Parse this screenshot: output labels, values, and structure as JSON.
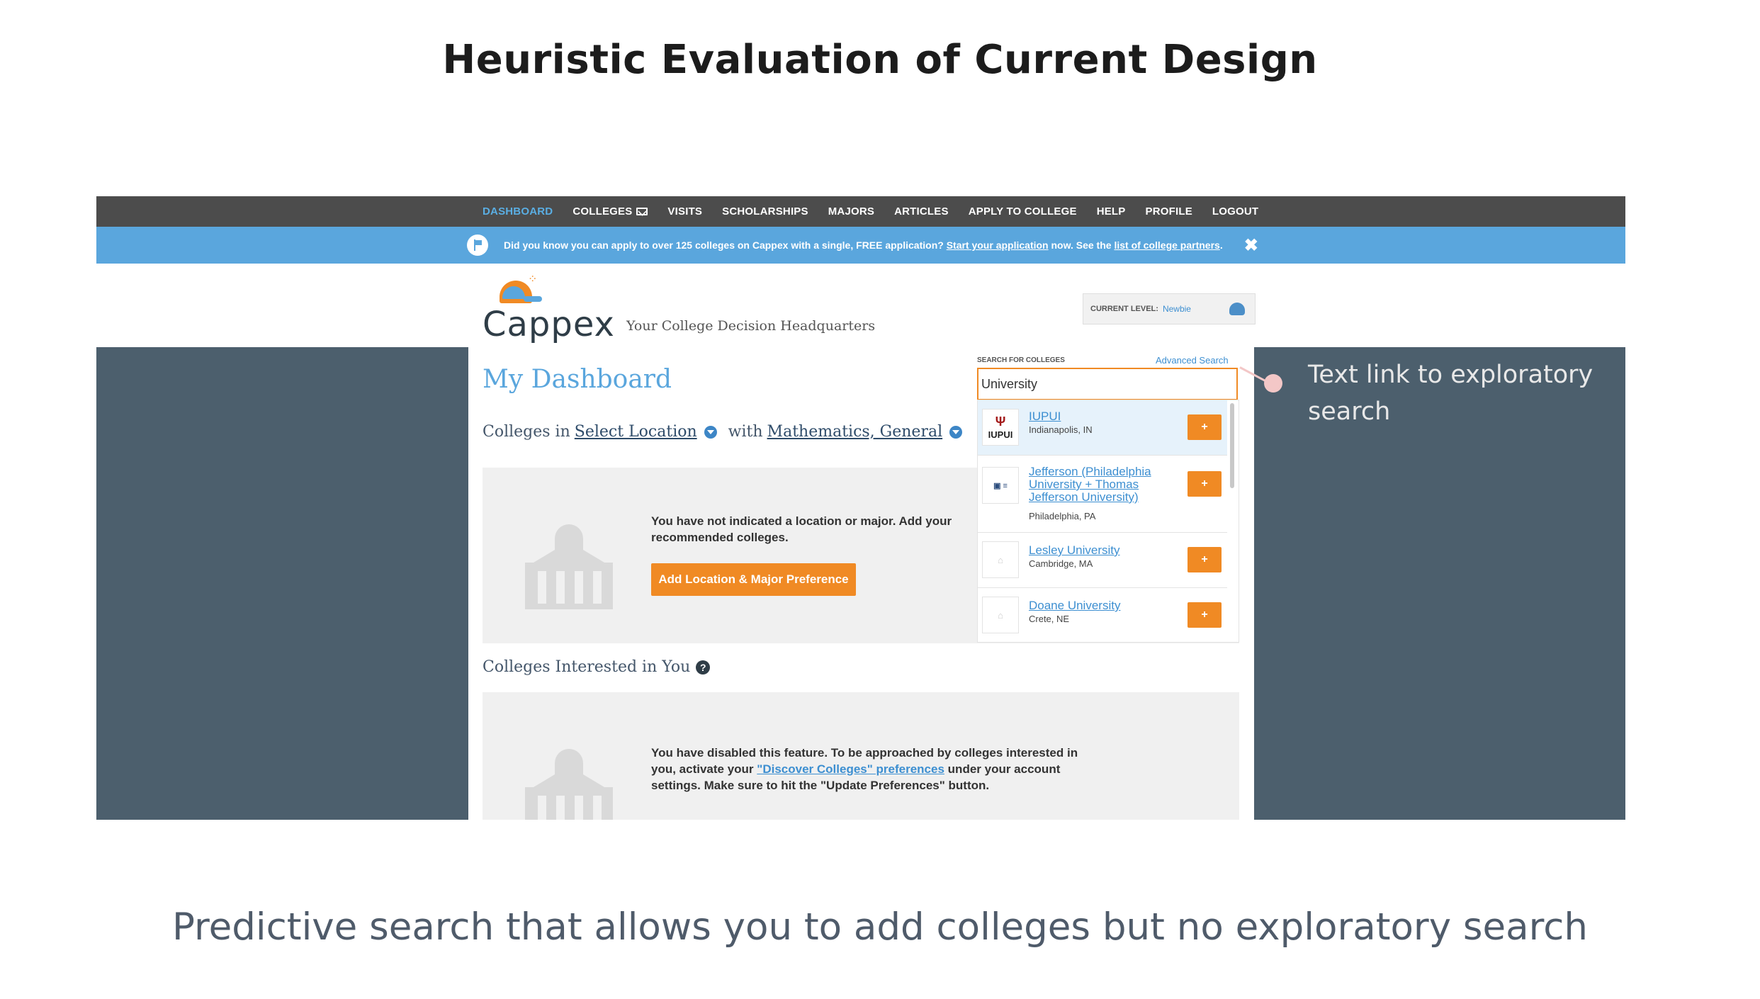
{
  "slide": {
    "title": "Heuristic Evaluation of Current Design",
    "caption": "Predictive search that allows you to add colleges but no exploratory search",
    "annotation": "Text link to exploratory search"
  },
  "nav": {
    "items": [
      "DASHBOARD",
      "COLLEGES",
      "VISITS",
      "SCHOLARSHIPS",
      "MAJORS",
      "ARTICLES",
      "APPLY TO COLLEGE",
      "HELP",
      "PROFILE",
      "LOGOUT"
    ],
    "active": "DASHBOARD"
  },
  "infobar": {
    "text_before": "Did you know you can apply to over 125 colleges on Cappex with a single, FREE application?",
    "link1": "Start your application",
    "text_middle": "now. See the",
    "link2": "list of college partners",
    "text_end": "."
  },
  "brand": {
    "logo": "Cappex",
    "tagline": "Your College Decision Headquarters"
  },
  "level": {
    "label": "CURRENT LEVEL:",
    "value": "Newbie"
  },
  "dashboard": {
    "title": "My Dashboard",
    "filter_prefix": "Colleges in",
    "location_link": "Select Location",
    "filter_with": "with",
    "major_link": "Mathematics, General",
    "card1_message": "You have not indicated a location or major. Add your recommended colleges.",
    "card1_button": "Add Location & Major Preference",
    "section2_title": "Colleges Interested in You",
    "card2_before": "You have disabled this feature. To be approached by colleges interested in you, activate your",
    "card2_link": "\"Discover Colleges\" preferences",
    "card2_after": "under your account settings. Make sure to hit the \"Update Preferences\" button."
  },
  "search": {
    "label": "SEARCH FOR COLLEGES",
    "advanced": "Advanced Search",
    "value": "University",
    "results": [
      {
        "logo": "IUPUI",
        "name": "IUPUI",
        "location": "Indianapolis, IN"
      },
      {
        "logo": "",
        "name": "Jefferson (Philadelphia University + Thomas Jefferson University)",
        "location": "Philadelphia, PA"
      },
      {
        "logo": "",
        "name": "Lesley University",
        "location": "Cambridge, MA"
      },
      {
        "logo": "",
        "name": "Doane University",
        "location": "Crete, NE"
      }
    ],
    "add_label": "+"
  }
}
